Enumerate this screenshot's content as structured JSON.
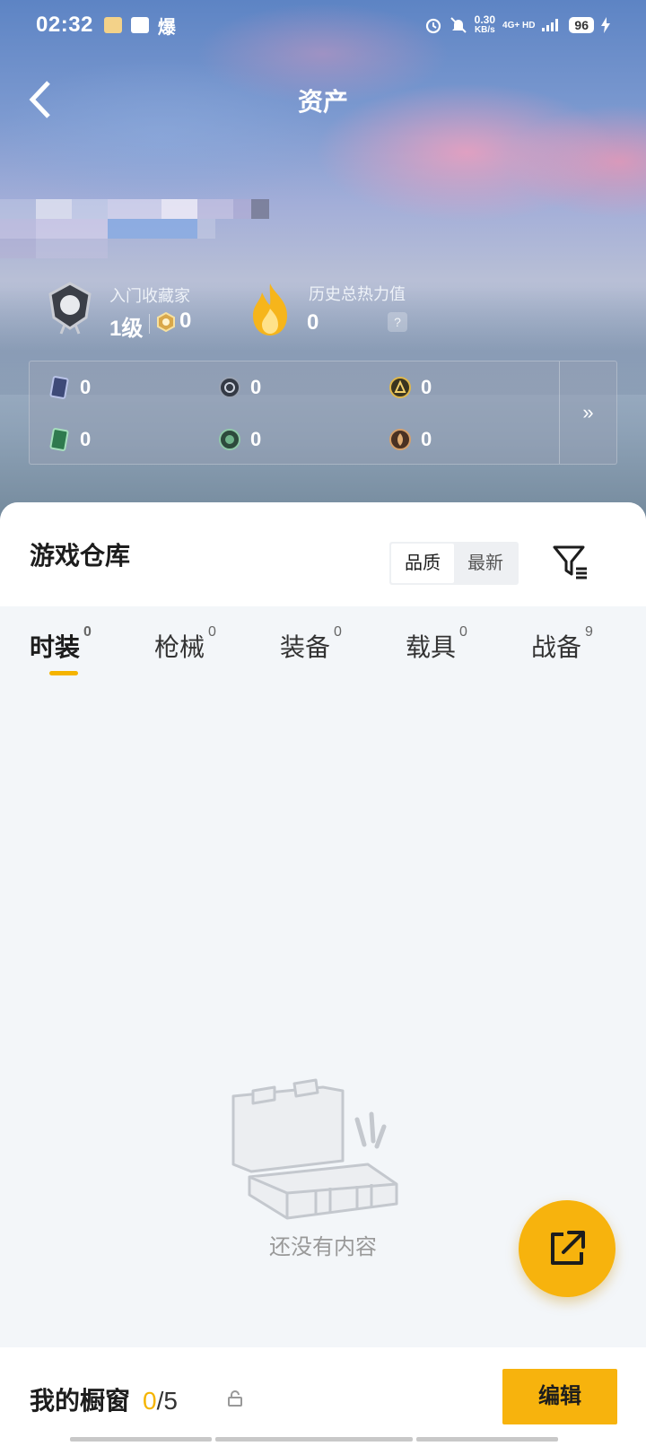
{
  "status_bar": {
    "time": "02:32",
    "notif_text": "爆",
    "speed": "0.30",
    "speed_unit": "KB/s",
    "network": "4G+ HD",
    "battery": "96"
  },
  "header": {
    "title": "资产"
  },
  "collector": {
    "title": "入门收藏家",
    "level": "1级",
    "coins": "0"
  },
  "heat": {
    "label": "历史总热力值",
    "value": "0",
    "help": "?"
  },
  "stats": {
    "items": [
      {
        "icon": "card-icon",
        "value": "0"
      },
      {
        "icon": "dark-coin-icon",
        "value": "0"
      },
      {
        "icon": "gold-coin-icon",
        "value": "0"
      },
      {
        "icon": "green-card-icon",
        "value": "0"
      },
      {
        "icon": "green-coin-icon",
        "value": "0"
      },
      {
        "icon": "bronze-coin-icon",
        "value": "0"
      }
    ],
    "more": "»"
  },
  "warehouse": {
    "title": "游戏仓库",
    "sort_options": [
      "品质",
      "最新"
    ],
    "active_sort": "品质",
    "tabs": [
      {
        "label": "时装",
        "count": "0"
      },
      {
        "label": "枪械",
        "count": "0"
      },
      {
        "label": "装备",
        "count": "0"
      },
      {
        "label": "载具",
        "count": "0"
      },
      {
        "label": "战备",
        "count": "9"
      }
    ],
    "active_tab": "时装",
    "empty_text": "还没有内容"
  },
  "showcase": {
    "title": "我的橱窗",
    "current": "0",
    "total": "/5",
    "edit_label": "编辑"
  },
  "colors": {
    "accent": "#f5b400",
    "fab": "#f7b30d",
    "background": "#f3f6f9"
  }
}
